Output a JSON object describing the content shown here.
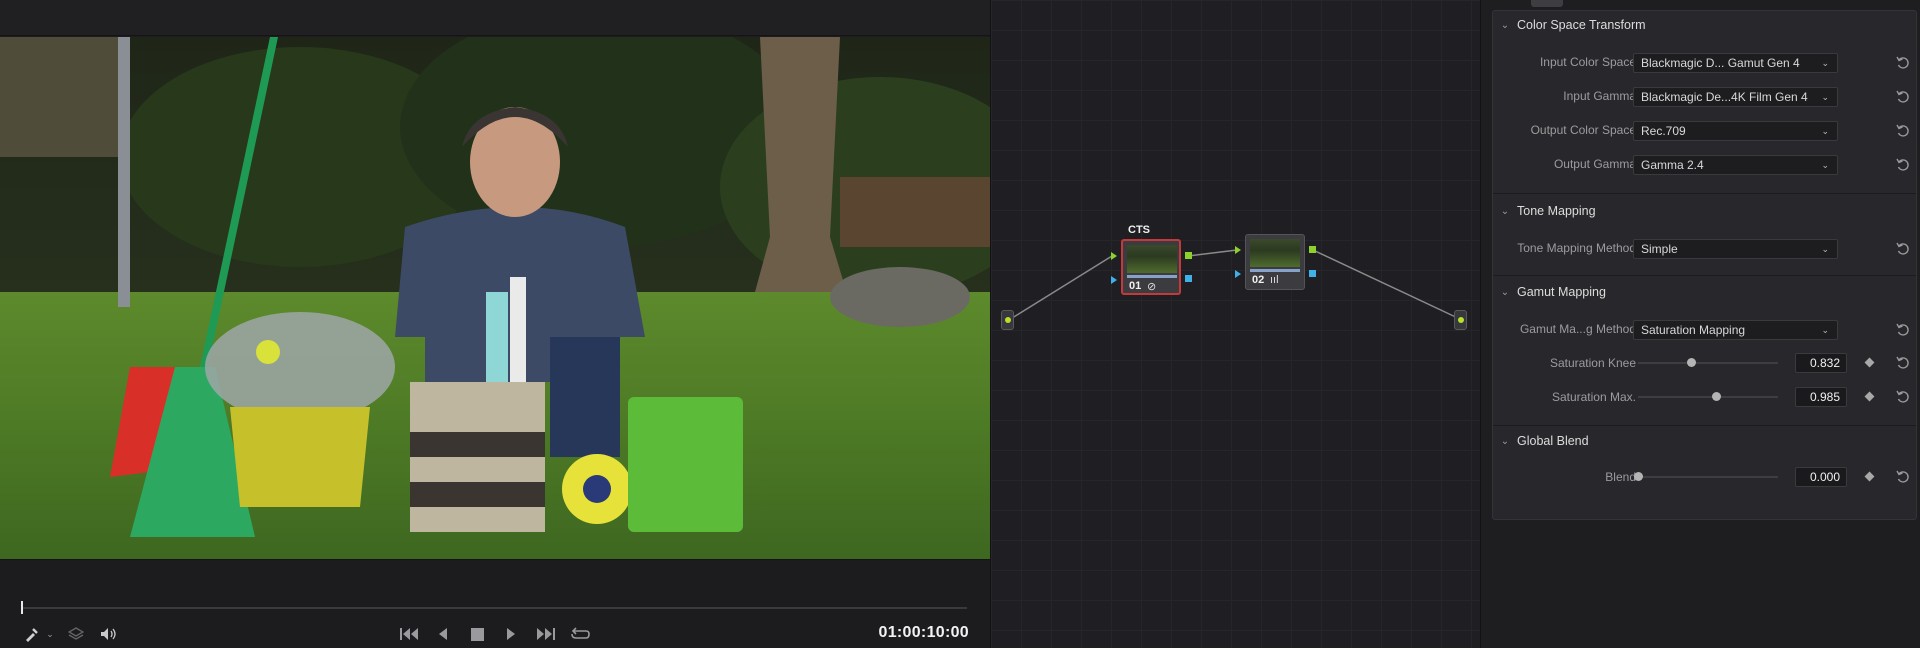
{
  "viewer": {
    "timecode": "01:00:10:00",
    "image_description_icon": "video-frame",
    "playhead_fraction": 0.0
  },
  "transport": {
    "icons": [
      "eyedropper-icon",
      "layers-icon",
      "speaker-icon",
      "jump-first-icon",
      "prev-frame-icon",
      "stop-icon",
      "play-icon",
      "jump-last-icon",
      "loop-icon"
    ]
  },
  "nodegraph": {
    "nodes": [
      {
        "label": "CTS",
        "number": "01",
        "icon": "⊘",
        "selected": true
      },
      {
        "label": "",
        "number": "02",
        "icon": "ııl",
        "selected": false
      }
    ],
    "colors": {
      "selected_border": "#c43a3a",
      "rgb_port": "#8fd12c",
      "key_port": "#3fb0e8"
    }
  },
  "inspector": {
    "color_space_transform": {
      "title": "Color Space Transform",
      "input_color_space": {
        "label": "Input Color Space",
        "value": "Blackmagic D... Gamut Gen 4"
      },
      "input_gamma": {
        "label": "Input Gamma",
        "value": "Blackmagic De...4K Film Gen 4"
      },
      "output_color_space": {
        "label": "Output Color Space",
        "value": "Rec.709"
      },
      "output_gamma": {
        "label": "Output Gamma",
        "value": "Gamma 2.4"
      }
    },
    "tone_mapping": {
      "title": "Tone Mapping",
      "method": {
        "label": "Tone Mapping Method",
        "value": "Simple"
      }
    },
    "gamut_mapping": {
      "title": "Gamut Mapping",
      "method": {
        "label": "Gamut Ma...g Method",
        "value": "Saturation Mapping"
      },
      "saturation_knee": {
        "label": "Saturation Knee",
        "value": "0.832",
        "slider_fraction": 0.38
      },
      "saturation_max": {
        "label": "Saturation Max.",
        "value": "0.985",
        "slider_fraction": 0.56
      }
    },
    "global_blend": {
      "title": "Global Blend",
      "blend": {
        "label": "Blend",
        "value": "0.000",
        "slider_fraction": 0.0
      }
    }
  }
}
